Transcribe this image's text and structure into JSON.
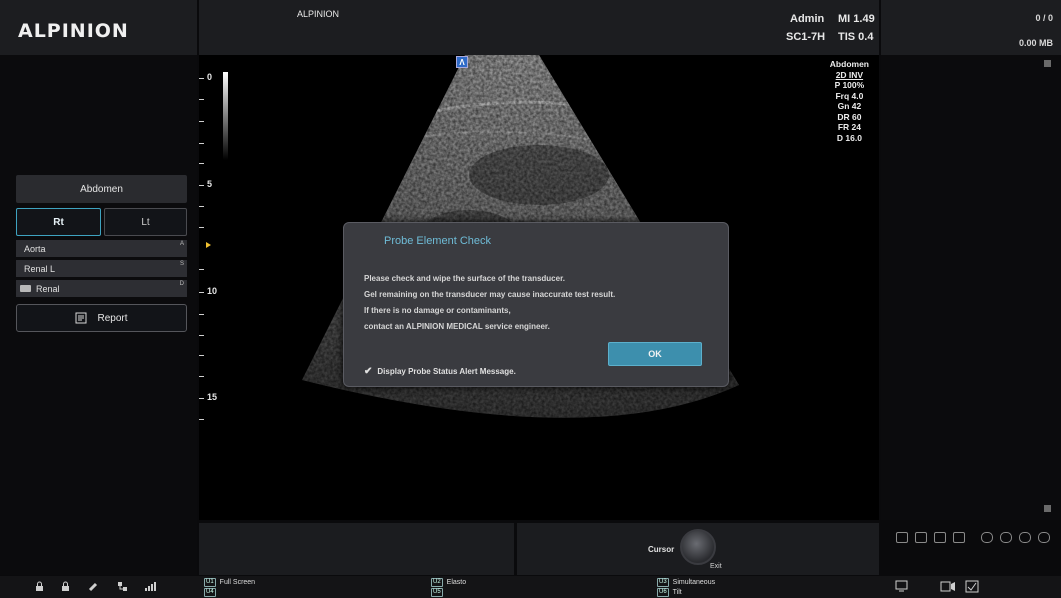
{
  "brand": {
    "logo": "ALPINION"
  },
  "header": {
    "hospital": "ALPINION",
    "user": "Admin",
    "mi": "MI 1.49",
    "probe": "SC1-7H",
    "tis": "TIS 0.4",
    "counter": "0 / 0",
    "storage": "0.00 MB"
  },
  "left_panel": {
    "anatomy": "Abdomen",
    "side_rt": "Rt",
    "side_lt": "Lt",
    "items": [
      {
        "label": "Aorta",
        "mark": "A"
      },
      {
        "label": "Renal L",
        "mark": "S"
      },
      {
        "label": "Renal",
        "mark": "D"
      }
    ],
    "report": "Report"
  },
  "image": {
    "depth_labels": [
      "0",
      "5",
      "10",
      "15"
    ],
    "params": {
      "preset": "Abdomen",
      "mode": "2D INV",
      "power": "P 100%",
      "freq": "Frq 4.0",
      "gain": "Gn 42",
      "dr": "DR 60",
      "fr": "FR 24",
      "depth": "D 16.0"
    }
  },
  "dialog": {
    "title": "Probe Element Check",
    "lines": [
      "Please check and wipe the surface of the transducer.",
      "Gel remaining on the transducer may cause inaccurate test result.",
      "If there is no damage or contaminants,",
      "contact an ALPINION MEDICAL service engineer."
    ],
    "ok": "OK",
    "checkbox_label": "Display Probe Status Alert Message.",
    "checkbox_checked": true
  },
  "controls": {
    "cursor": "Cursor",
    "exit": "Exit"
  },
  "user_keys": [
    {
      "key": "U1",
      "label": "Full Screen"
    },
    {
      "key": "U4",
      "label": ""
    },
    {
      "key": "U2",
      "label": "Elasto"
    },
    {
      "key": "U5",
      "label": ""
    },
    {
      "key": "U3",
      "label": "Simultaneous"
    },
    {
      "key": "U6",
      "label": "Tilt"
    }
  ],
  "status_icons": [
    "lock-icon",
    "lock-icon",
    "usb-icon",
    "network-icon",
    "signal-icon"
  ],
  "colors": {
    "accent": "#3ea3c0",
    "dialog_title": "#6fbcd7",
    "ok_button": "#3d8fad"
  }
}
